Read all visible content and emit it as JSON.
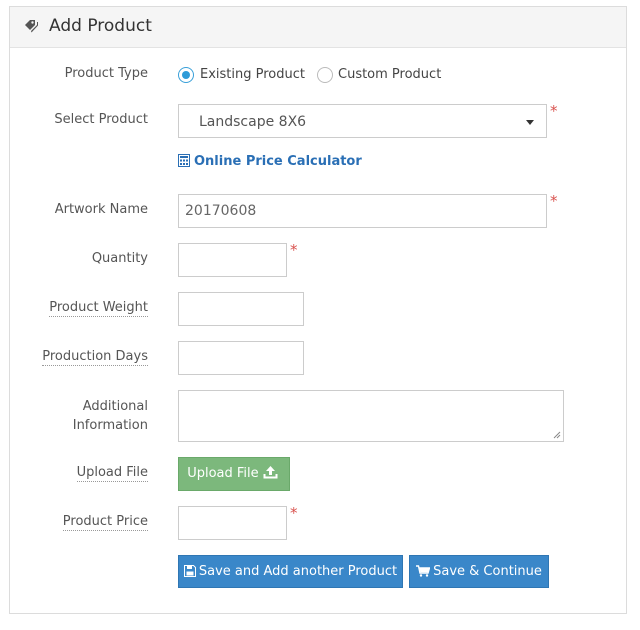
{
  "panel": {
    "title": "Add Product"
  },
  "form": {
    "product_type": {
      "label": "Product Type",
      "options": [
        {
          "label": "Existing Product",
          "selected": true
        },
        {
          "label": "Custom Product",
          "selected": false
        }
      ]
    },
    "select_product": {
      "label": "Select Product",
      "value": "Landscape 8X6",
      "required": true
    },
    "price_calculator_link": "Online Price Calculator",
    "artwork_name": {
      "label": "Artwork Name",
      "value": "20170608",
      "required": true
    },
    "quantity": {
      "label": "Quantity",
      "value": "",
      "required": true
    },
    "product_weight": {
      "label": "Product Weight",
      "value": ""
    },
    "production_days": {
      "label": "Production Days",
      "value": ""
    },
    "additional_information": {
      "label_line1": "Additional",
      "label_line2": "Information",
      "value": ""
    },
    "upload_file": {
      "label": "Upload File",
      "button_label": "Upload File"
    },
    "product_price": {
      "label": "Product Price",
      "value": "",
      "required": true
    }
  },
  "required_marker": "*",
  "actions": {
    "save_add_another": "Save and Add another Product",
    "save_continue": "Save & Continue"
  },
  "colors": {
    "accent_blue": "#3a87c9",
    "upload_green": "#7cb87c",
    "required_red": "#d9534f",
    "link_blue": "#2a6fb5"
  },
  "icons": {
    "header": "tags-icon",
    "calculator": "calculator-icon",
    "upload": "upload-icon",
    "save": "floppy-disk-icon",
    "cart": "cart-icon"
  }
}
